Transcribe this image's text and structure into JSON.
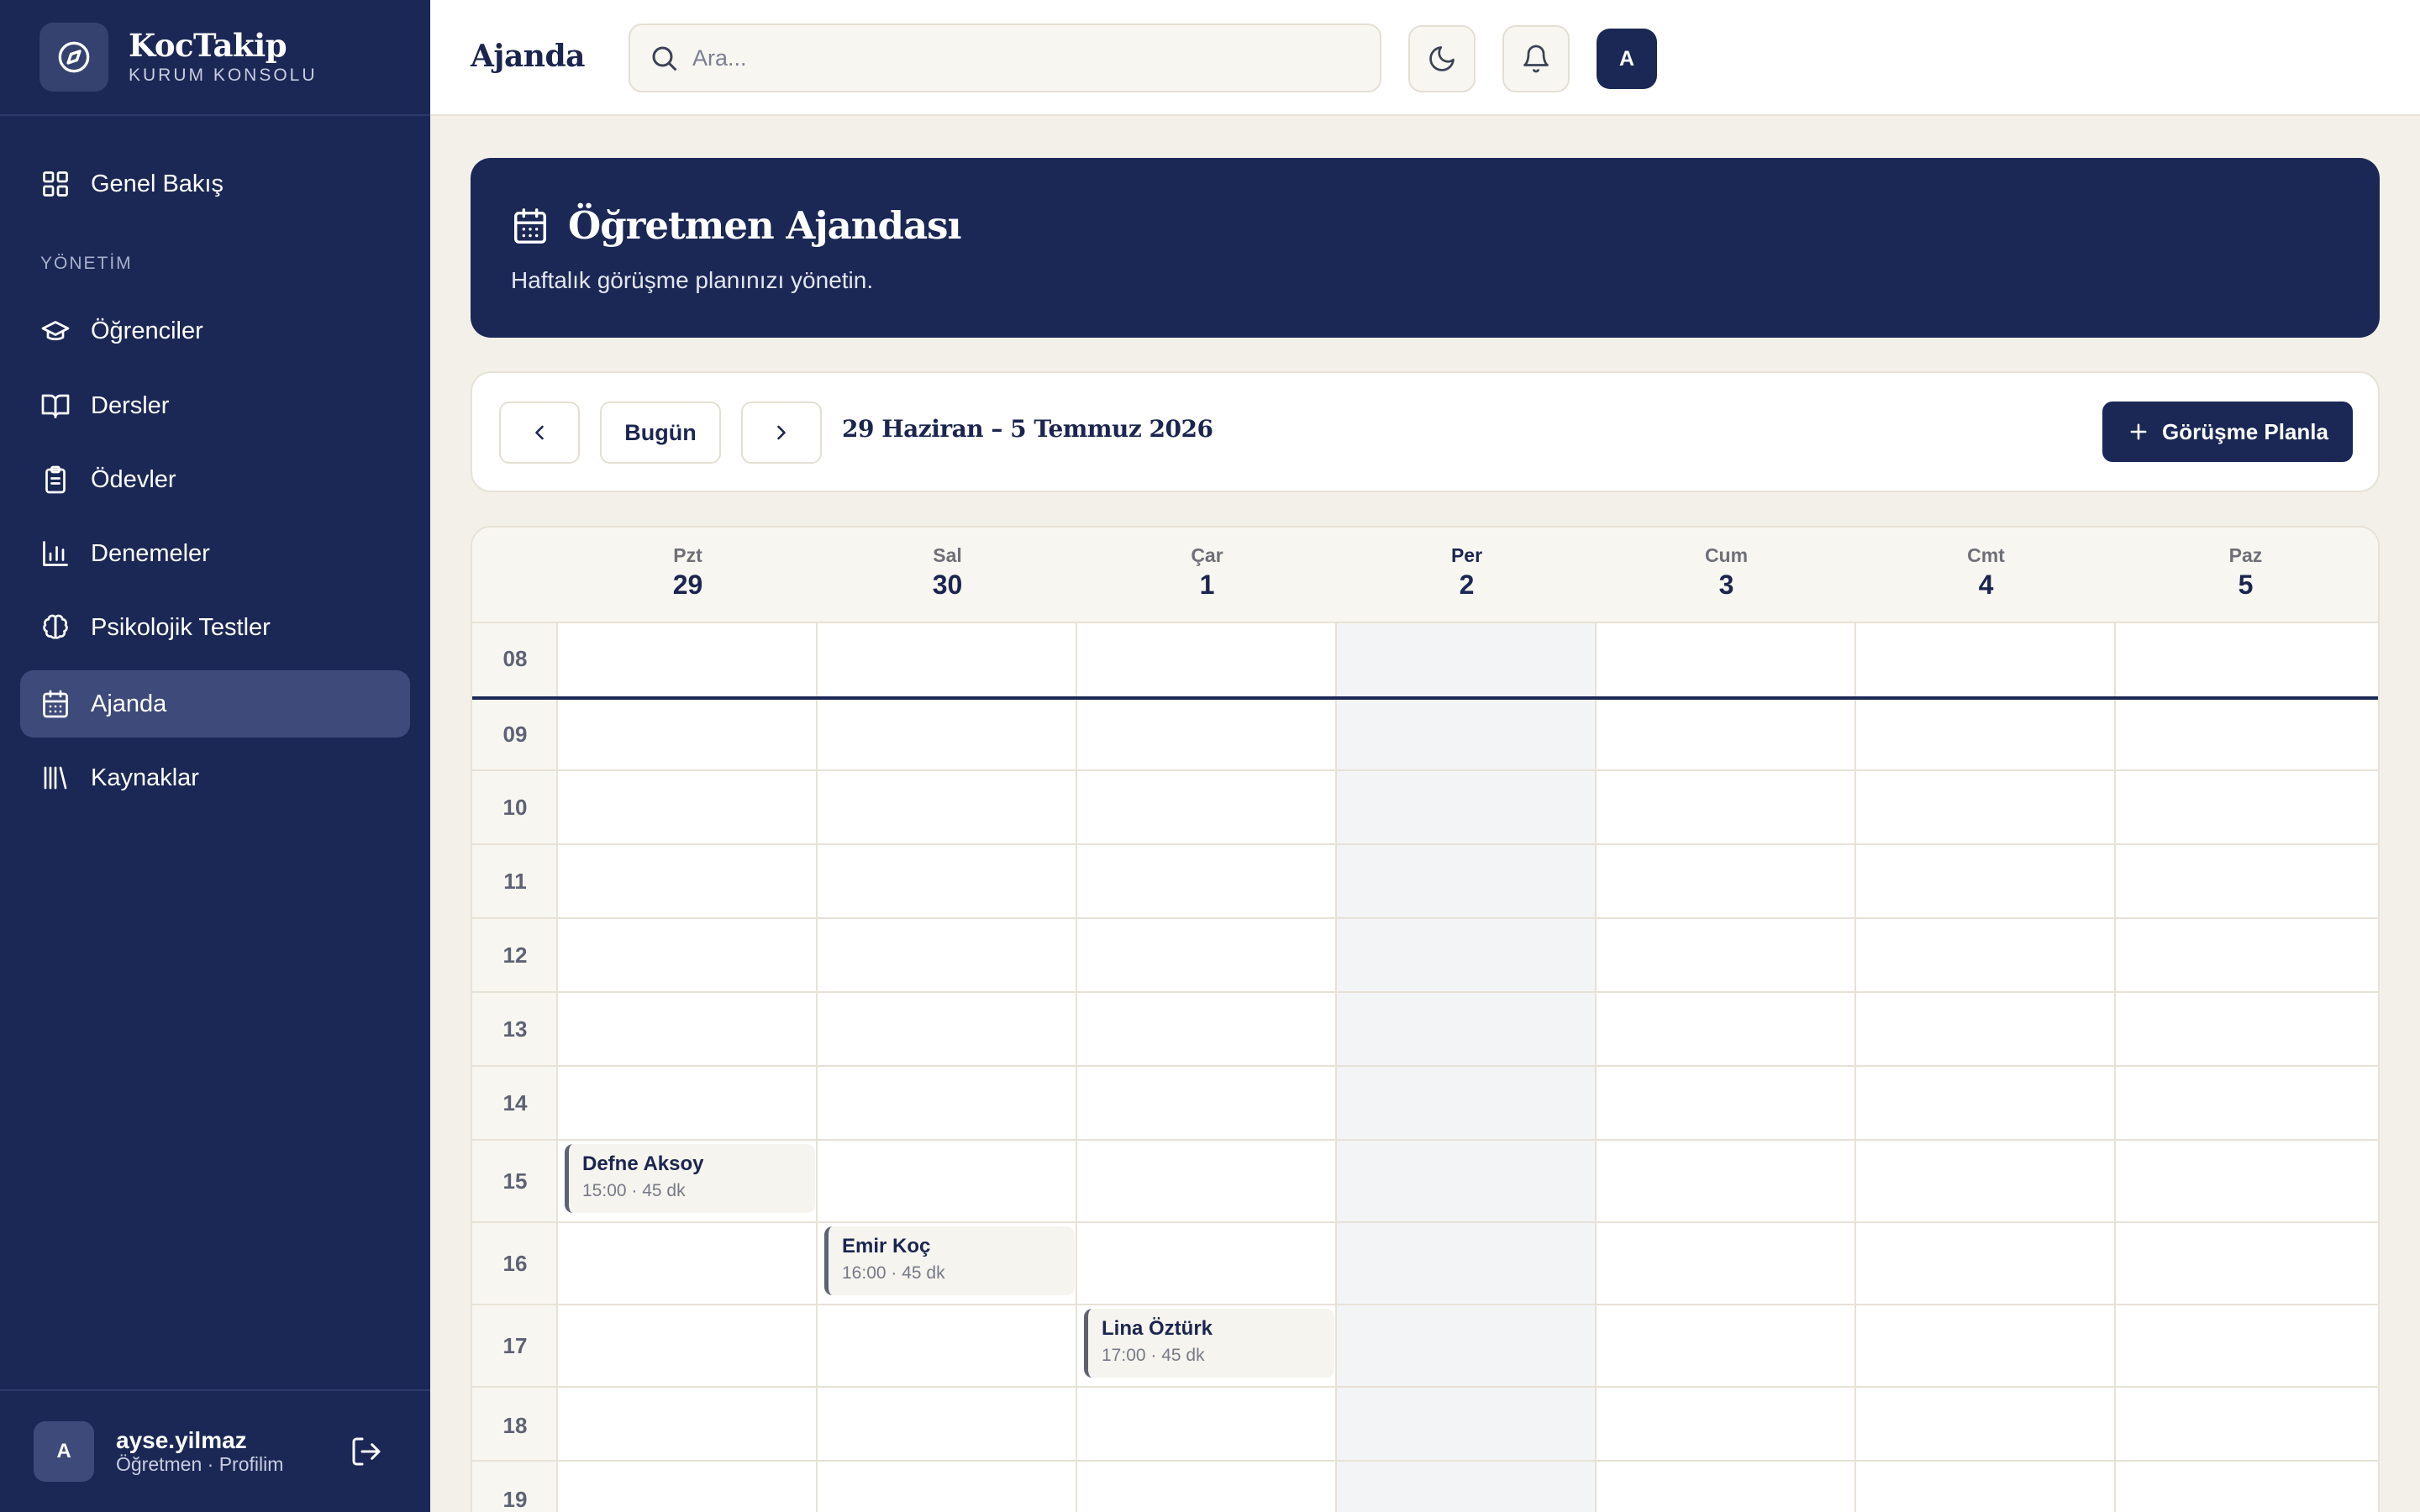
{
  "brand": {
    "name": "KocTakip",
    "subtitle": "KURUM KONSOLU"
  },
  "sidebar": {
    "items": [
      {
        "label": "Genel Bakış",
        "icon": "grid-icon"
      },
      {
        "label": "Öğrenciler",
        "icon": "graduation-cap-icon"
      },
      {
        "label": "Dersler",
        "icon": "book-icon"
      },
      {
        "label": "Ödevler",
        "icon": "clipboard-icon"
      },
      {
        "label": "Denemeler",
        "icon": "bar-chart-icon"
      },
      {
        "label": "Psikolojik Testler",
        "icon": "brain-icon"
      },
      {
        "label": "Ajanda",
        "icon": "calendar-icon",
        "active": true
      },
      {
        "label": "Kaynaklar",
        "icon": "library-icon"
      }
    ],
    "section_label": "YÖNETİM",
    "user": {
      "initial": "A",
      "name": "ayse.yilmaz",
      "role": "Öğretmen · Profilim"
    }
  },
  "header": {
    "title": "Ajanda",
    "search_placeholder": "Ara...",
    "avatar_initial": "A"
  },
  "banner": {
    "title": "Öğretmen Ajandası",
    "subtitle": "Haftalık görüşme planınızı yönetin."
  },
  "toolbar": {
    "today_label": "Bugün",
    "range": "29 Haziran – 5 Temmuz 2026",
    "plan_label": "Görüşme Planla"
  },
  "calendar": {
    "days": [
      {
        "name": "Pzt",
        "num": "29"
      },
      {
        "name": "Sal",
        "num": "30"
      },
      {
        "name": "Çar",
        "num": "1"
      },
      {
        "name": "Per",
        "num": "2",
        "today": true
      },
      {
        "name": "Cum",
        "num": "3"
      },
      {
        "name": "Cmt",
        "num": "4"
      },
      {
        "name": "Paz",
        "num": "5"
      }
    ],
    "hours": [
      "08",
      "09",
      "10",
      "11",
      "12",
      "13",
      "14",
      "15",
      "16",
      "17",
      "18",
      "19"
    ],
    "events": [
      {
        "name": "Defne Aksoy",
        "time": "15:00 · 45 dk"
      },
      {
        "name": "Emir Koç",
        "time": "16:00 · 45 dk"
      },
      {
        "name": "Lina Öztürk",
        "time": "17:00 · 45 dk"
      }
    ]
  },
  "colors": {
    "navy": "#1b2856",
    "background": "#f3f0e9",
    "today_column": "#f3f4f6"
  }
}
